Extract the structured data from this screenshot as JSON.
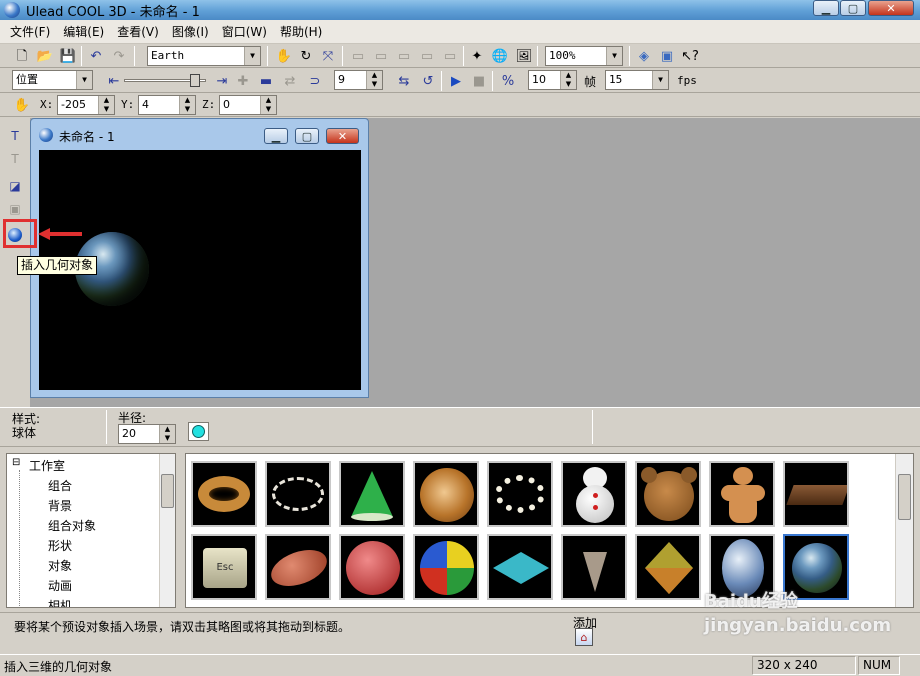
{
  "window": {
    "title": "Ulead COOL 3D - 未命名 - 1"
  },
  "menu": [
    "文件(F)",
    "编辑(E)",
    "查看(V)",
    "图像(I)",
    "窗口(W)",
    "帮助(H)"
  ],
  "toolbar": {
    "font_name": "Earth",
    "zoom": "100%"
  },
  "animation_bar": {
    "property": "位置",
    "current_frame": "9",
    "total_frames": "10",
    "frames_label": "帧",
    "fps_value": "15",
    "fps_label": "fps"
  },
  "position_bar": {
    "x_label": "X:",
    "x_value": "-205",
    "y_label": "Y:",
    "y_value": "4",
    "z_label": "Z:",
    "z_value": "0"
  },
  "document": {
    "title": "未命名 - 1",
    "object": "earth globe",
    "size": "320 x 240"
  },
  "tooltip": "插入几何对象",
  "property_bar": {
    "style_label": "样式:",
    "style_value": "球体",
    "radius_label": "半径:",
    "radius_value": "20",
    "color": "#23e0e0"
  },
  "tree": {
    "root": "工作室",
    "items": [
      "组合",
      "背景",
      "组合对象",
      "形状",
      "对象",
      "动画",
      "相机"
    ]
  },
  "thumbnails": [
    {
      "name": "donut"
    },
    {
      "name": "ring"
    },
    {
      "name": "cone"
    },
    {
      "name": "swirl-disc"
    },
    {
      "name": "pearl-necklace"
    },
    {
      "name": "snowman"
    },
    {
      "name": "bear"
    },
    {
      "name": "gingerbread"
    },
    {
      "name": "chocolate-bar"
    },
    {
      "name": "esc-key"
    },
    {
      "name": "football"
    },
    {
      "name": "basketball"
    },
    {
      "name": "beach-ball"
    },
    {
      "name": "spinning-top"
    },
    {
      "name": "drill-bit"
    },
    {
      "name": "cone-face"
    },
    {
      "name": "egg"
    },
    {
      "name": "earth"
    }
  ],
  "hint": "要将某个预设对象插入场景，请双击其略图或将其拖动到标题。",
  "add_label": "添加",
  "status": {
    "text": "插入三维的几何对象",
    "size": "320 x 240",
    "num": "NUM"
  },
  "watermark": "Baidu经验 jingyan.baidu.com"
}
